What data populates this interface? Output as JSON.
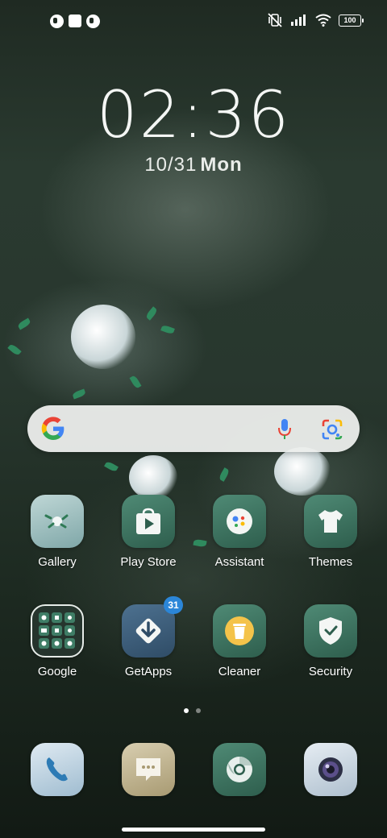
{
  "status": {
    "battery": "100"
  },
  "clock": {
    "time": "02:36",
    "date": "10/31",
    "day": "Mon"
  },
  "home": {
    "rows": [
      [
        {
          "label": "Gallery",
          "icon": "gallery-icon"
        },
        {
          "label": "Play Store",
          "icon": "play-store-icon"
        },
        {
          "label": "Assistant",
          "icon": "assistant-icon"
        },
        {
          "label": "Themes",
          "icon": "themes-icon"
        }
      ],
      [
        {
          "label": "Google",
          "icon": "google-folder-icon"
        },
        {
          "label": "GetApps",
          "icon": "getapps-icon",
          "badge": "31"
        },
        {
          "label": "Cleaner",
          "icon": "cleaner-icon"
        },
        {
          "label": "Security",
          "icon": "security-icon"
        }
      ]
    ]
  },
  "dock": [
    {
      "icon": "phone-icon"
    },
    {
      "icon": "messages-icon"
    },
    {
      "icon": "chrome-icon"
    },
    {
      "icon": "camera-icon"
    }
  ],
  "colors": {
    "accent_green": "#3a6b5a",
    "badge_blue": "#2b86d8",
    "google_blue": "#4285F4",
    "google_red": "#EA4335",
    "google_yellow": "#FBBC05",
    "google_green": "#34A853"
  }
}
